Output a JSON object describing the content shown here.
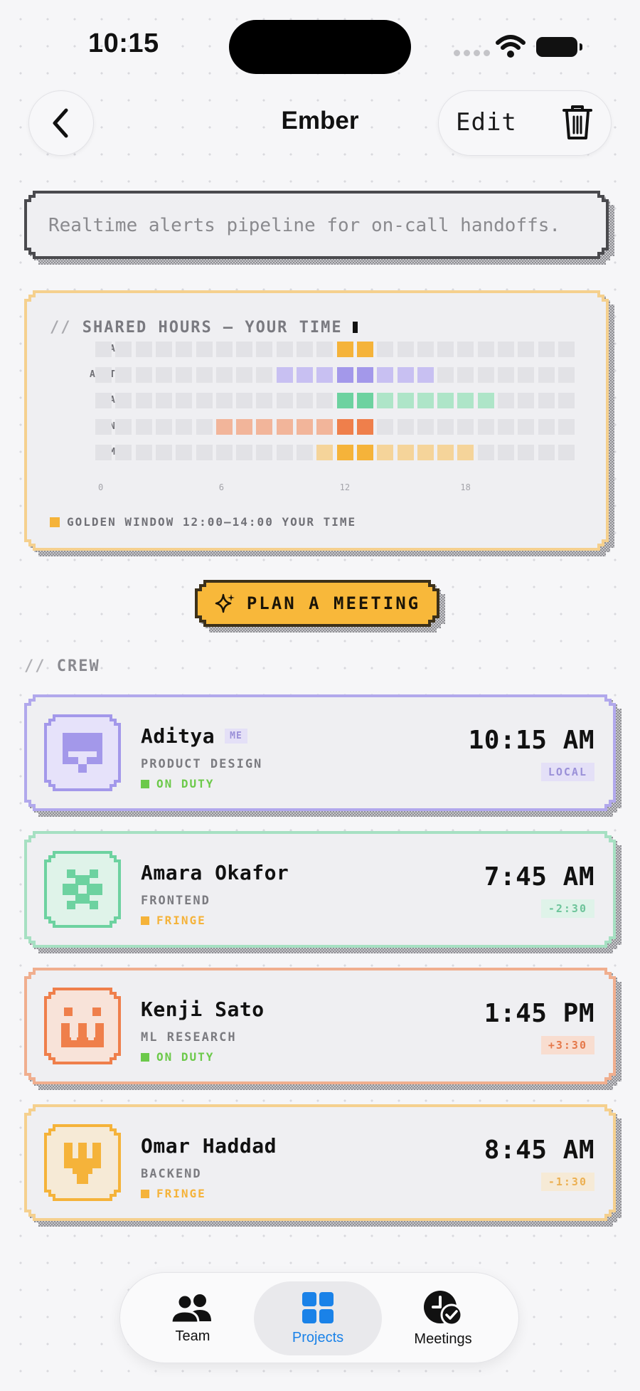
{
  "status_bar": {
    "time": "10:15"
  },
  "header": {
    "title": "Ember",
    "edit_label": "Edit"
  },
  "description": "Realtime alerts pipeline for on-call handoffs.",
  "shared_hours": {
    "title": "SHARED HOURS — YOUR TIME",
    "prefix": "//",
    "rows": [
      {
        "label": "ALL",
        "cells": [
          0,
          0,
          0,
          0,
          0,
          0,
          0,
          0,
          0,
          0,
          0,
          0,
          2,
          2,
          0,
          0,
          0,
          0,
          0,
          0,
          0,
          0,
          0,
          0
        ]
      },
      {
        "label": "ADITYA",
        "cells": [
          0,
          0,
          0,
          0,
          0,
          0,
          0,
          0,
          0,
          1,
          1,
          1,
          2,
          2,
          1,
          1,
          1,
          0,
          0,
          0,
          0,
          0,
          0,
          0
        ]
      },
      {
        "label": "AMARA",
        "cells": [
          0,
          0,
          0,
          0,
          0,
          0,
          0,
          0,
          0,
          0,
          0,
          0,
          2,
          2,
          1,
          1,
          1,
          1,
          1,
          1,
          0,
          0,
          0,
          0
        ]
      },
      {
        "label": "KENJI",
        "cells": [
          0,
          0,
          0,
          0,
          0,
          0,
          1,
          1,
          1,
          1,
          1,
          1,
          2,
          2,
          0,
          0,
          0,
          0,
          0,
          0,
          0,
          0,
          0,
          0
        ]
      },
      {
        "label": "OMAR",
        "cells": [
          0,
          0,
          0,
          0,
          0,
          0,
          0,
          0,
          0,
          0,
          0,
          1,
          2,
          2,
          1,
          1,
          1,
          1,
          1,
          0,
          0,
          0,
          0,
          0
        ]
      }
    ],
    "row_colors": [
      {
        "light": "#e2e2e6",
        "dark": "#f5b33a"
      },
      {
        "light": "#c8c0f2",
        "dark": "#a398ea"
      },
      {
        "light": "#aee5c8",
        "dark": "#6dd2a0"
      },
      {
        "light": "#f2b59a",
        "dark": "#ef7f4b"
      },
      {
        "light": "#f5d49a",
        "dark": "#f5b33a"
      }
    ],
    "axis_ticks": [
      "0",
      "6",
      "12",
      "18"
    ],
    "legend": "GOLDEN WINDOW 12:00–14:00 YOUR TIME"
  },
  "plan_button": {
    "label": "PLAN A MEETING"
  },
  "crew": {
    "prefix": "//",
    "title": "CREW",
    "members": [
      {
        "name": "Aditya",
        "badge": "ME",
        "role": "PRODUCT DESIGN",
        "status": "ON DUTY",
        "time": "10:15 AM",
        "offset": "LOCAL",
        "border": "#b1a8ec",
        "avatar_bg": "#e6e2fa",
        "avatar_fg": "#a398ea",
        "status_color": "#6cc94a",
        "offset_bg": "#e4e0f7",
        "offset_fg": "#9a90d8",
        "icon": "robot-avatar-icon"
      },
      {
        "name": "Amara Okafor",
        "badge": "",
        "role": "FRONTEND",
        "status": "FRINGE",
        "time": "7:45 AM",
        "offset": "-2:30",
        "border": "#a6e0c2",
        "avatar_bg": "#dff3e9",
        "avatar_fg": "#6dd2a0",
        "status_color": "#f5b33a",
        "offset_bg": "#dff3e9",
        "offset_fg": "#6dc49a",
        "icon": "flower-avatar-icon"
      },
      {
        "name": "Kenji Sato",
        "badge": "",
        "role": "ML RESEARCH",
        "status": "ON DUTY",
        "time": "1:45 PM",
        "offset": "+3:30",
        "border": "#f0ae8e",
        "avatar_bg": "#f8e3d9",
        "avatar_fg": "#ef7f4b",
        "status_color": "#6cc94a",
        "offset_bg": "#f8ddd0",
        "offset_fg": "#e5784a",
        "icon": "face-avatar-icon"
      },
      {
        "name": "Omar Haddad",
        "badge": "",
        "role": "BACKEND",
        "status": "FRINGE",
        "time": "8:45 AM",
        "offset": "-1:30",
        "border": "#f5d08e",
        "avatar_bg": "#f6ead6",
        "avatar_fg": "#f5b33a",
        "status_color": "#f5b33a",
        "offset_bg": "#f6ead6",
        "offset_fg": "#ecb052",
        "icon": "trident-avatar-icon"
      }
    ]
  },
  "tabbar": {
    "tabs": [
      {
        "label": "Team",
        "icon": "people-icon"
      },
      {
        "label": "Projects",
        "icon": "grid-icon",
        "active": true
      },
      {
        "label": "Meetings",
        "icon": "clock-check-icon"
      }
    ]
  }
}
